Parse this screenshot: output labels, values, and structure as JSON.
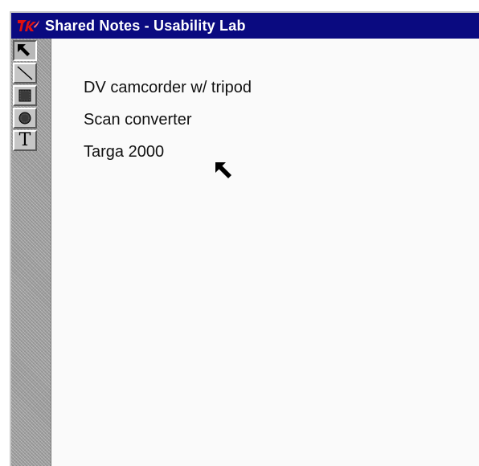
{
  "window": {
    "title": "Shared Notes - Usability Lab",
    "logo_icon": "tk-feather-logo",
    "titlebar_color": "#0a0a80"
  },
  "toolbar": {
    "tools": [
      {
        "name": "select-tool",
        "icon": "arrow-pointer-icon",
        "active": true
      },
      {
        "name": "line-tool",
        "icon": "diagonal-line-icon",
        "active": false
      },
      {
        "name": "rectangle-tool",
        "icon": "filled-square-icon",
        "active": false
      },
      {
        "name": "oval-tool",
        "icon": "filled-circle-icon",
        "active": false
      },
      {
        "name": "text-tool",
        "icon": "text-T-icon",
        "active": false
      }
    ],
    "text_tool_glyph": "T"
  },
  "canvas": {
    "notes": [
      "DV camcorder w/ tripod",
      "Scan converter",
      "Targa 2000"
    ],
    "remote_pointer_icon": "arrow-pointer-icon"
  }
}
